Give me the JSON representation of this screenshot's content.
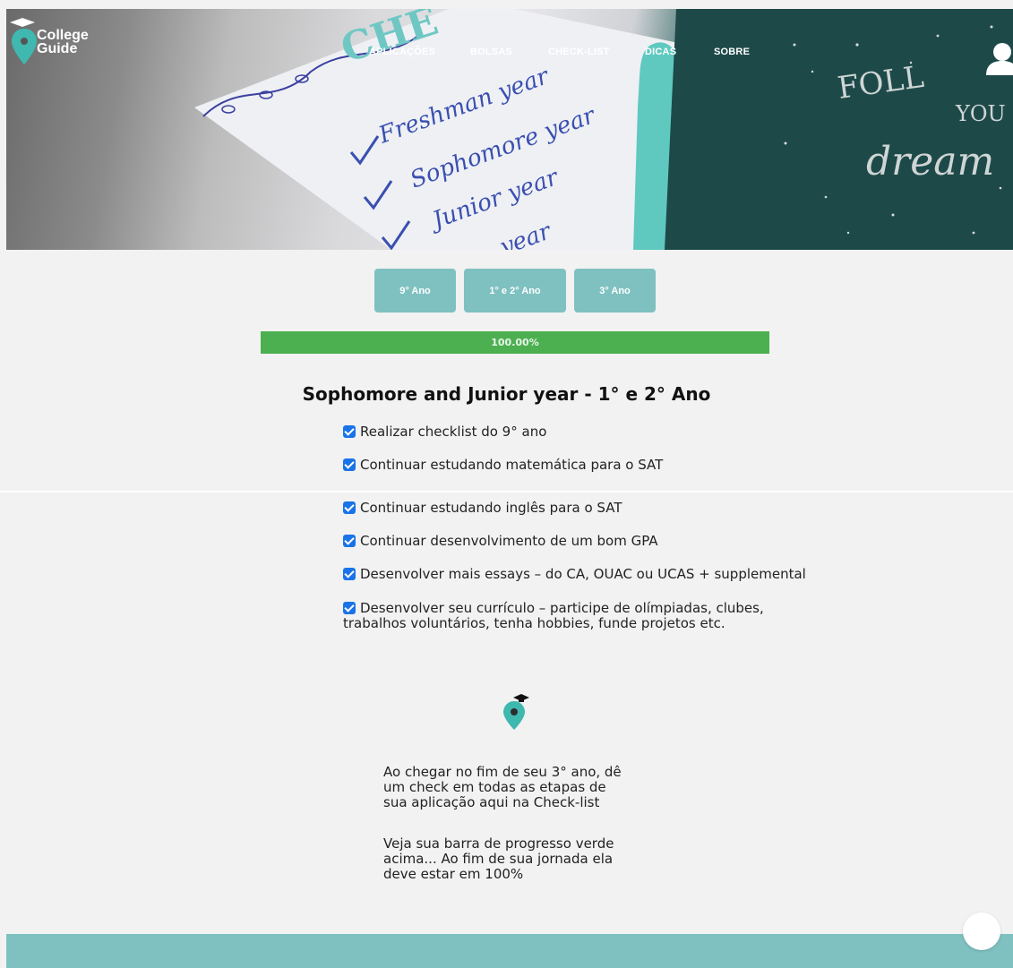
{
  "brand": {
    "line1": "College",
    "line2": "Guide"
  },
  "nav": [
    {
      "label": "APLICAÇÕES"
    },
    {
      "label": "BOLSAS"
    },
    {
      "label": "CHECK-LIST"
    },
    {
      "label": "DICAS"
    },
    {
      "label": "SOBRE"
    }
  ],
  "hero_note": {
    "heading": "CHE",
    "lines": [
      "Freshman year",
      "Sophomore year",
      "Junior year",
      "year"
    ],
    "notebook_text": [
      "FOLL",
      "YOU",
      "dream"
    ]
  },
  "tabs": [
    {
      "label": "9° Ano"
    },
    {
      "label": "1° e 2° Ano"
    },
    {
      "label": "3° Ano"
    }
  ],
  "progress": {
    "label": "100.00%",
    "value": 1.0,
    "color": "#4caf50"
  },
  "section": {
    "title": "Sophomore and Junior year - 1° e 2° Ano",
    "items": [
      {
        "text": "Realizar checklist do 9° ano",
        "checked": true
      },
      {
        "text": "Continuar estudando matemática para o SAT",
        "checked": true
      },
      {
        "text": "Continuar estudando inglês para o SAT",
        "checked": true
      },
      {
        "text": "Continuar desenvolvimento de um bom GPA",
        "checked": true
      },
      {
        "text": "Desenvolver mais essays – do CA, OUAC ou UCAS + supplemental",
        "checked": true
      },
      {
        "text": "Desenvolver seu currículo – participe de olímpiadas, clubes,",
        "text2": "trabalhos voluntários, tenha hobbies, funde projetos etc.",
        "checked": true
      }
    ]
  },
  "info": {
    "p1": [
      "Ao chegar no fim de seu 3° ano, dê",
      "um check em todas as etapas de",
      "sua aplicação aqui na Check-list"
    ],
    "p2": [
      "Veja sua barra de progresso verde",
      "acima... Ao fim de sua jornada ela",
      "deve estar em 100%"
    ]
  },
  "colors": {
    "accent_teal": "#7fc1c0",
    "pin_teal": "#3fb8b0",
    "progress_green": "#4caf50",
    "checkbox_blue": "#1a73e8",
    "background": "#f2f2f2"
  },
  "icons": [
    "location-pin-icon",
    "graduation-cap-icon",
    "user-icon",
    "checkbox-checked-icon"
  ]
}
